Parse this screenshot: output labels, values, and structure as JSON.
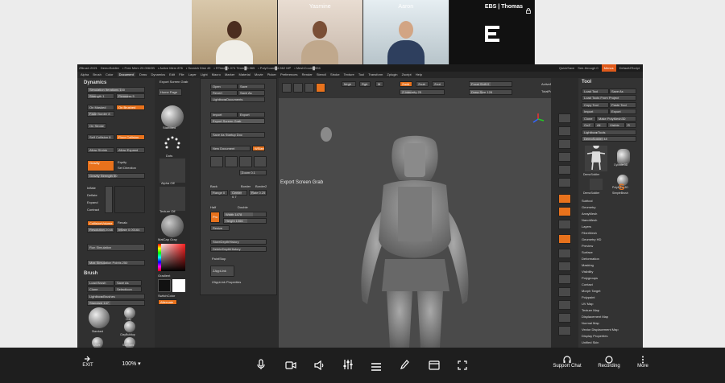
{
  "participants": [
    {
      "name": ""
    },
    {
      "name": "Yasmine"
    },
    {
      "name": "Aaron"
    },
    {
      "name": "EBS | Thomas"
    }
  ],
  "zbrush": {
    "title_bar": [
      "ZBrush 2021",
      "DemoSoldier",
      "• Free Mem 20.006GB",
      "• Active Mem 876",
      "• Scratch Disk 49",
      "• RTime█1.074 Timer█0.965",
      "• PolyCount█4.562 MP",
      "• MeshCount█594"
    ],
    "quicksave": "QuickSave",
    "see_through": "See-through 0",
    "menus": "Menus",
    "default_script": "DefaultZScript",
    "menu": [
      "Alpha",
      "Brush",
      "Color",
      "Document",
      "Draw",
      "Dynamics",
      "Edit",
      "File",
      "Layer",
      "Light",
      "Macro",
      "Marker",
      "Material",
      "Movie",
      "Picker",
      "Preferences",
      "Render",
      "Stencil",
      "Stroke",
      "Texture",
      "Tool",
      "Transform",
      "Zplugin",
      "Zscript",
      "Help"
    ],
    "menu_active": "Document",
    "left_panel": {
      "dynamics_title": "Dynamics",
      "sim_iterations": "Simulation Iterations 100",
      "strength": "Strength 1",
      "firmness": "Firmness 5",
      "on_masked": "On Masked",
      "on_brushed": "On Brushed",
      "fade_border": "Fade Border 8",
      "on_stroke": "On Stroke",
      "use_collision": "Self Collision 8",
      "floor_collision": "Floor Collision",
      "allow_shrink": "Allow Shrink",
      "allow_expand": "Allow Expand",
      "gravity": "Gravity",
      "gravity_strength": "Gravity Strength 50",
      "gravity_hint": "Set Direction",
      "gravity_eq": "Equity",
      "inflate": "Inflate",
      "deflate": "Deflate",
      "expand": "Expand",
      "contract": "Contract",
      "collision_volume": "CollisionVolume",
      "recalc": "Recalc",
      "resolution": "Resolution 2048",
      "inflate_val": "Inflate 0.00164",
      "run_sim": "Run Simulation",
      "max_sim_points": "Max Simulation Points 250",
      "brush_title": "Brush",
      "load_brush": "Load Brush",
      "save_as": "Save As",
      "clone": "Clone",
      "select_icon": "SelectIcon",
      "lightbox_brushes": "Lightbox▸Brushes",
      "standard": "Standard 147",
      "brushes": [
        "Standard",
        "Clay",
        "ClayBuildup",
        "Move",
        "Standard"
      ]
    },
    "doc_panel": {
      "export_screen_grab": "Export Screen Grab",
      "home_page": "Home Page",
      "lightbox": "LightBox",
      "standard": "Standard",
      "dots": "Dots",
      "alpha_off": "Alpha Off",
      "texture_off": "Texture Off",
      "matcap": "MatCap Gray",
      "gradient": "Gradient",
      "switch_color": "SwitchColor",
      "alternate": "Alternate",
      "open": "Open",
      "save": "Save",
      "revert": "Revert",
      "save_as": "Save As",
      "lightbox_documents": "Lightbox▸Documents",
      "import": "Import",
      "export": "Export",
      "export_grab": "Export Screen Grab",
      "save_startup": "Save As Startup Doc",
      "new_document": "New Document",
      "wsize": "WSize",
      "zoom": "Zoom 0.1",
      "back": "Back",
      "border": "Border",
      "border2": "Border2",
      "range": "Range 0",
      "center": "Center 0.7",
      "rate": "Rate 0.25",
      "half": "Half",
      "double": "Double",
      "pro": "Pro",
      "width": "Width 1478",
      "height": "Height 1066",
      "resize": "Resize",
      "store_depth": "StoreDepthHistory",
      "delete_depth": "DeleteDepthHistory",
      "paint_stop": "PaintStop",
      "zapplink": "ZAppLink",
      "zapplink_props": "ZAppLink Properties",
      "tooltip": "Export Screen Grab"
    },
    "top_toolbar": {
      "mrgb": "Mrgb",
      "rgb": "Rgb",
      "m": "M",
      "zadd": "Zadd",
      "zsub": "Zsub",
      "zcut": "Zcut",
      "focal_shift": "Focal Shift 0",
      "draw_size": "Draw Size 128",
      "z_intensity": "Z Intensity 25",
      "active_points": "ActivePoints: 36",
      "total_points": "TotalPoints: 6.9"
    },
    "right_panel": {
      "tool_title": "Tool",
      "load_tool": "Load Tool",
      "save_as": "Save As",
      "load_from_project": "Load Tools From Project",
      "copy_tool": "Copy Tool",
      "paste_tool": "Paste Tool",
      "import": "Import",
      "export": "Export",
      "clone": "Clone",
      "make_polymesh": "Make PolyMesh3D",
      "goz": "GoZ",
      "all": "All",
      "visible": "Visible",
      "r": "R",
      "lightbox_tools": "Lightbox▸Tools",
      "demo_soldier": "DemoSoldier 48",
      "tools": [
        "DemoSoldier",
        "Cylinder3D",
        "DemoSoldier",
        "PolyMesh3D",
        "SimpleBrush"
      ],
      "list": [
        "Subtool",
        "Geometry",
        "ArrayMesh",
        "NanoMesh",
        "Layers",
        "FiberMesh",
        "Geometry HD",
        "Preview",
        "Surface",
        "Deformation",
        "Masking",
        "Visibility",
        "Polygroups",
        "Contact",
        "Morph Target",
        "Polypaint",
        "UV Map",
        "Texture Map",
        "Displacement Map",
        "Normal Map",
        "Vector Displacement Map",
        "Display Properties",
        "Unified Skin"
      ]
    }
  },
  "bottom_bar": {
    "exit": "EXIT",
    "zoom": "100%",
    "support_chat": "Support Chat",
    "recording": "Recording",
    "more": "More"
  },
  "colors": {
    "accent_orange": "#e8721c",
    "panel": "#383838",
    "viewport": "#4a4a4a",
    "bar": "#1e1e1e"
  }
}
